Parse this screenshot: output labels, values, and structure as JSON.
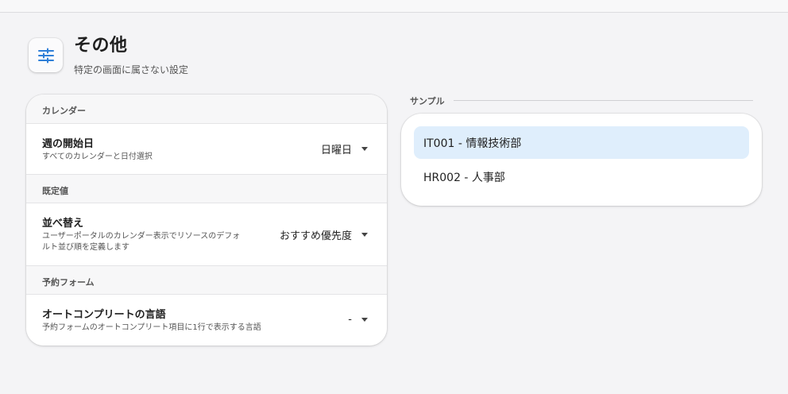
{
  "header": {
    "title": "その他",
    "subtitle": "特定の画面に属さない設定",
    "icon": "sliders-icon"
  },
  "settings": {
    "sections": [
      {
        "header": "カレンダー",
        "row": {
          "title": "週の開始日",
          "description": "すべてのカレンダーと日付選択",
          "value": "日曜日"
        }
      },
      {
        "header": "既定値",
        "row": {
          "title": "並べ替え",
          "description_line1": "ユーザーポータルのカレンダー表示でリソースのデフォ",
          "description_line2": "ルト並び順を定義します",
          "value": "おすすめ優先度"
        }
      },
      {
        "header": "予約フォーム",
        "row": {
          "title": "オートコンプリートの言語",
          "description": "予約フォームのオートコンプリート項目に1行で表示する言語",
          "value": "-"
        }
      }
    ]
  },
  "sample": {
    "label": "サンプル",
    "items": [
      {
        "label": "IT001 - 情報技術部",
        "selected": true
      },
      {
        "label": "HR002 - 人事部",
        "selected": false
      }
    ]
  },
  "colors": {
    "accent": "#2f7fd8",
    "selected_bg": "#dfeefc",
    "page_bg": "#f4f4f6"
  }
}
